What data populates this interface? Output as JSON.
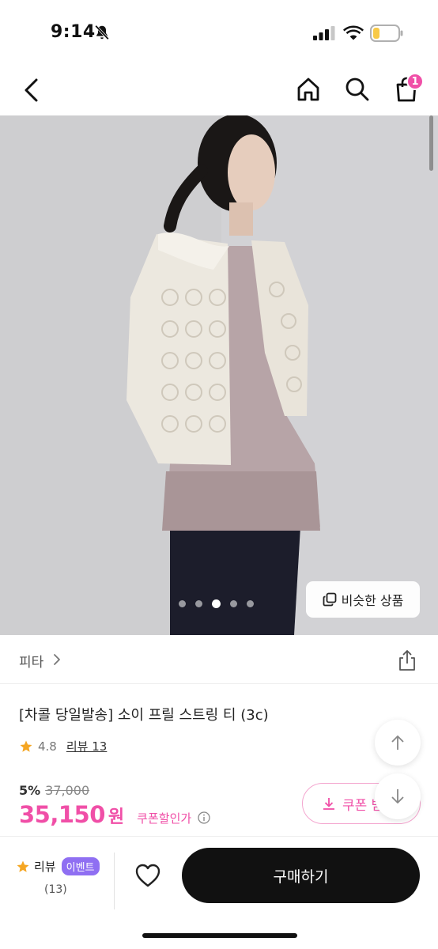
{
  "status_bar": {
    "time": "9:14",
    "icons": [
      "bell-slash-icon",
      "cellular-signal-icon",
      "wifi-icon",
      "battery-icon"
    ]
  },
  "nav": {
    "icons": [
      "chevron-left-icon",
      "home-icon",
      "search-icon",
      "shopping-bag-icon"
    ],
    "cart_count": "1"
  },
  "gallery": {
    "slide_count": 5,
    "active_slide": 3,
    "similar_label": "비슷한 상품"
  },
  "product": {
    "brand": "피타",
    "title": "[차콜 당일발송] 소이 프릴 스트링 티 (3c)",
    "rating": "4.8",
    "review_label": "리뷰 13",
    "discount_rate": "5%",
    "original_price": "37,000",
    "final_price": "35,150",
    "currency": "원",
    "coupon_price_label": "쿠폰할인가"
  },
  "coupon": {
    "label": "쿠폰 받기"
  },
  "bottom_bar": {
    "review_label": "리뷰",
    "event_label": "이벤트",
    "review_count": "(13)",
    "buy_label": "구매하기"
  },
  "colors": {
    "accent": "#f04fa7",
    "event_badge": "#8f6ff2",
    "buy_button": "#111111",
    "star": "#f5a623"
  }
}
